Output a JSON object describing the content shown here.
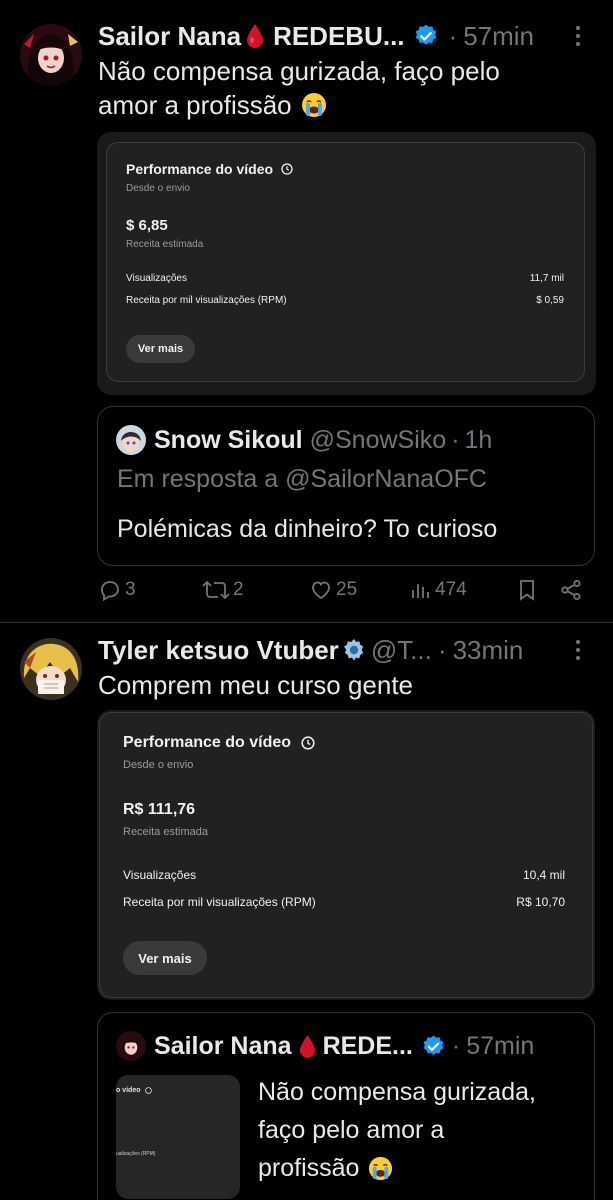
{
  "tweet1": {
    "name": "Sailor Nana",
    "name_suffix": "REDEBU...",
    "time": "57min",
    "text_line1": "Não compensa gurizada, faço pelo",
    "text_line2": "amor a profissão",
    "card": {
      "title": "Performance do vídeo",
      "subtitle": "Desde o envio",
      "revenue": "$ 6,85",
      "revenue_label": "Receita estimada",
      "views_label": "Visualizações",
      "views_value": "11,7 mil",
      "rpm_label": "Receita por mil visualizações (RPM)",
      "rpm_value": "$ 0,59",
      "button": "Ver mais"
    },
    "quote": {
      "name": "Snow Sikoul",
      "handle": "@SnowSiko",
      "time": "1h",
      "reply_to": "Em resposta a @SailorNanaOFC",
      "text": "Polémicas da dinheiro? To curioso"
    },
    "actions": {
      "replies": "3",
      "reposts": "2",
      "likes": "25",
      "views": "474"
    }
  },
  "tweet2": {
    "name": "Tyler ketsuo Vtuber",
    "handle": "@T...",
    "time": "33min",
    "text": "Comprem meu curso gente",
    "card": {
      "title": "Performance do vídeo",
      "subtitle": "Desde o envio",
      "revenue": "R$ 111,76",
      "revenue_label": "Receita estimada",
      "views_label": "Visualizações",
      "views_value": "10,4 mil",
      "rpm_label": "Receita por mil visualizações (RPM)",
      "rpm_value": "R$ 10,70",
      "button": "Ver mais"
    },
    "quote": {
      "name": "Sailor Nana",
      "name_suffix": "REDE...",
      "time": "57min",
      "text_line1": "Não compensa gurizada,",
      "text_line2": "faço pelo amor a",
      "text_line3": "profissão",
      "thumb_title": "o vídeo",
      "thumb_label": "ualizações (RPM)"
    }
  },
  "colors": {
    "background": "#000000",
    "text": "#e7e9ea",
    "muted": "#71767b",
    "verified": "#1d9bf0",
    "blood_drop": "#d3112a"
  },
  "icons": [
    "more-icon",
    "verified-badge-icon",
    "blood-drop-icon",
    "crying-face-icon",
    "clock-icon",
    "gear-icon",
    "reply-icon",
    "repost-icon",
    "like-icon",
    "views-icon",
    "bookmark-icon",
    "share-icon"
  ]
}
